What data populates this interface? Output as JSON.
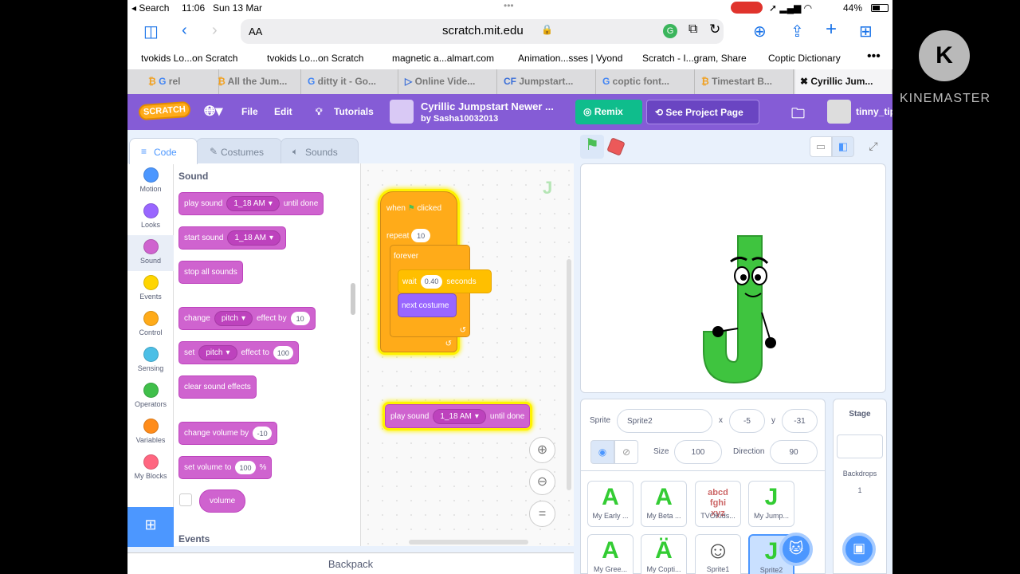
{
  "status": {
    "search": "◂ Search",
    "time": "11:06",
    "date": "Sun 13 Mar",
    "battery": "44%"
  },
  "browser": {
    "aa": "AA",
    "url": "scratch.mit.edu",
    "favorites": [
      "tvokids Lo...on Scratch",
      "tvokids Lo...on Scratch",
      "magnetic a...almart.com",
      "Animation...sses | Vyond",
      "Scratch - I...gram, Share",
      "Coptic Dictionary"
    ],
    "tabs": [
      "rel",
      "All the Jum...",
      "ditty it - Go...",
      "Online Vide...",
      "Jumpstart...",
      "coptic font...",
      "Timestart B...",
      "Cyrillic Jum..."
    ]
  },
  "scratch": {
    "logo": "SCRATCH",
    "file": "File",
    "edit": "Edit",
    "tutorials": "Tutorials",
    "project_title": "Cyrillic Jumpstart Newer ...",
    "author": "by Sasha10032013",
    "remix": "Remix",
    "see_project": "See Project Page",
    "user": "tinny_tip",
    "tabs": {
      "code": "Code",
      "costumes": "Costumes",
      "sounds": "Sounds"
    },
    "categories": [
      {
        "label": "Motion",
        "color": "#4c97ff"
      },
      {
        "label": "Looks",
        "color": "#9966ff"
      },
      {
        "label": "Sound",
        "color": "#cf63cf"
      },
      {
        "label": "Events",
        "color": "#ffd500"
      },
      {
        "label": "Control",
        "color": "#ffab19"
      },
      {
        "label": "Sensing",
        "color": "#4cbfe6"
      },
      {
        "label": "Operators",
        "color": "#40bf4a"
      },
      {
        "label": "Variables",
        "color": "#ff8c1a"
      },
      {
        "label": "My Blocks",
        "color": "#ff6680"
      }
    ],
    "palette": {
      "sound_heading": "Sound",
      "events_heading": "Events",
      "play_sound": "play sound",
      "until_done": "until done",
      "sound_name": "1_18 AM",
      "start_sound": "start sound",
      "stop_all": "stop all sounds",
      "change": "change",
      "set": "set",
      "pitch": "pitch",
      "effect_by": "effect by",
      "effect_to": "effect to",
      "change_val": "10",
      "set_val": "100",
      "clear_effects": "clear sound effects",
      "change_volume": "change volume by",
      "change_volume_val": "-10",
      "set_volume": "set volume to",
      "set_volume_val": "100",
      "percent": "%",
      "volume": "volume"
    },
    "script": {
      "when": "when",
      "clicked": "clicked",
      "repeat": "repeat",
      "repeat_val": "10",
      "forever": "forever",
      "wait": "wait",
      "wait_val": "0.40",
      "seconds": "seconds",
      "next_costume": "next costume",
      "play_sound": "play sound",
      "sound_name": "1_18 AM",
      "until_done": "until done"
    },
    "backpack": "Backpack",
    "sprite_info": {
      "sprite_label": "Sprite",
      "sprite_name": "Sprite2",
      "x_label": "x",
      "x": "-5",
      "y_label": "y",
      "y": "-31",
      "size_label": "Size",
      "size": "100",
      "direction_label": "Direction",
      "direction": "90"
    },
    "stage_panel": {
      "title": "Stage",
      "backdrops_label": "Backdrops",
      "backdrops": "1"
    },
    "sprites": [
      "My Early ...",
      "My Beta ...",
      "TVOKids...",
      "My Jump...",
      "My Gree...",
      "My Copti...",
      "Sprite1",
      "Sprite2"
    ]
  },
  "watermark": {
    "brand": "KINEMASTER",
    "letter": "K"
  }
}
